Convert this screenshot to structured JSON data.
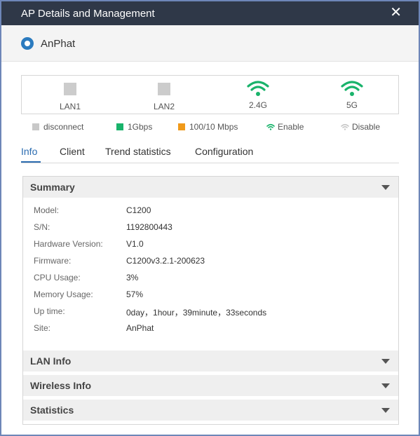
{
  "window": {
    "title": "AP Details and Management",
    "close_icon": "close-icon"
  },
  "device": {
    "name": "AnPhat",
    "status_icon": "radio-dot-icon",
    "status_color": "#2b7bbf"
  },
  "ports": [
    {
      "label": "LAN1",
      "icon": "port-square-icon",
      "state": "disconnect"
    },
    {
      "label": "LAN2",
      "icon": "port-square-icon",
      "state": "disconnect"
    },
    {
      "label": "2.4G",
      "icon": "wifi-icon",
      "state": "Enable"
    },
    {
      "label": "5G",
      "icon": "wifi-icon",
      "state": "Enable"
    }
  ],
  "legend": [
    {
      "label": "disconnect",
      "color": "#c8c8c8",
      "icon": "square-swatch-icon"
    },
    {
      "label": "1Gbps",
      "color": "#19b36b",
      "icon": "square-swatch-icon"
    },
    {
      "label": "100/10 Mbps",
      "color": "#f09a1a",
      "icon": "square-swatch-icon"
    },
    {
      "label": "Enable",
      "color": "#19b36b",
      "icon": "wifi-icon"
    },
    {
      "label": "Disable",
      "color": "#c8c8c8",
      "icon": "wifi-icon"
    }
  ],
  "tabs": [
    {
      "label": "Info",
      "active": true
    },
    {
      "label": "Client",
      "active": false
    },
    {
      "label": "Trend statistics",
      "active": false
    },
    {
      "label": "Configuration",
      "active": false
    }
  ],
  "summary": {
    "title": "Summary",
    "rows": [
      {
        "key": "Model:",
        "value": "C1200"
      },
      {
        "key": "S/N:",
        "value": "1192800443"
      },
      {
        "key": "Hardware Version:",
        "value": "V1.0"
      },
      {
        "key": "Firmware:",
        "value": "C1200v3.2.1-200623"
      },
      {
        "key": "CPU Usage:",
        "value": "3%"
      },
      {
        "key": "Memory Usage:",
        "value": "57%"
      },
      {
        "key": "Up time:",
        "value": "0day，1hour，39minute，33seconds"
      },
      {
        "key": "Site:",
        "value": "AnPhat"
      }
    ]
  },
  "sections": [
    {
      "title": "LAN Info"
    },
    {
      "title": "Wireless Info"
    },
    {
      "title": "Statistics"
    }
  ],
  "colors": {
    "titlebar": "#2f3848",
    "accent": "#2b6cb0",
    "wifi_green": "#19b36b"
  }
}
